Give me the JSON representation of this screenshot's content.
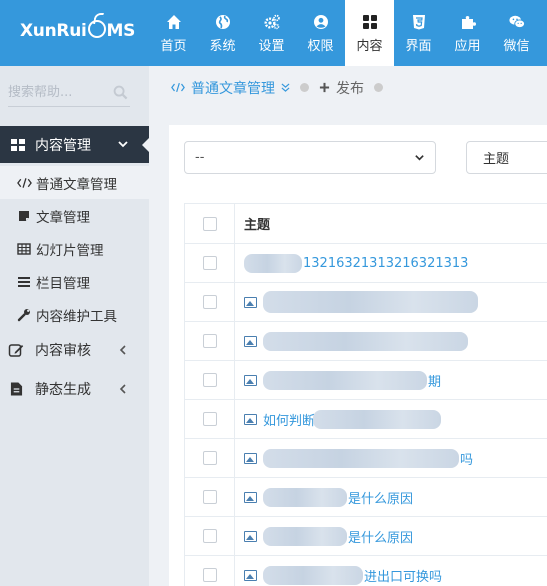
{
  "logo": {
    "left": "XunRui",
    "right": "MS"
  },
  "nav": [
    {
      "label": "首页",
      "icon": "home-icon"
    },
    {
      "label": "系统",
      "icon": "globe-icon"
    },
    {
      "label": "设置",
      "icon": "gears-icon"
    },
    {
      "label": "权限",
      "icon": "user-icon"
    },
    {
      "label": "内容",
      "icon": "grid-icon",
      "active": true
    },
    {
      "label": "界面",
      "icon": "html5-icon"
    },
    {
      "label": "应用",
      "icon": "puzzle-icon"
    },
    {
      "label": "微信",
      "icon": "wechat-icon"
    }
  ],
  "sidebar": {
    "search_placeholder": "搜索帮助...",
    "section": "内容管理",
    "items": [
      "普通文章管理",
      "文章管理",
      "幻灯片管理",
      "栏目管理",
      "内容维护工具"
    ],
    "groups": [
      "内容审核",
      "静态生成"
    ]
  },
  "breadcrumb": {
    "current": "普通文章管理",
    "action": "发布"
  },
  "filters": {
    "select_value": "--",
    "field_value": "主题"
  },
  "table": {
    "header": "主题",
    "rows": [
      {
        "tail": "13216321313216321313"
      },
      {
        "tail": ""
      },
      {
        "tail": ""
      },
      {
        "tail": "期"
      },
      {
        "lead": "如何判断"
      },
      {
        "tail": "吗"
      },
      {
        "tail": "是什么原因"
      },
      {
        "tail": "是什么原因"
      },
      {
        "tail": "进出口可换吗"
      }
    ]
  },
  "colors": {
    "primary": "#3598dc",
    "sidebar_dark": "#2b3643",
    "sidebar_bg": "#e2e7ed"
  }
}
